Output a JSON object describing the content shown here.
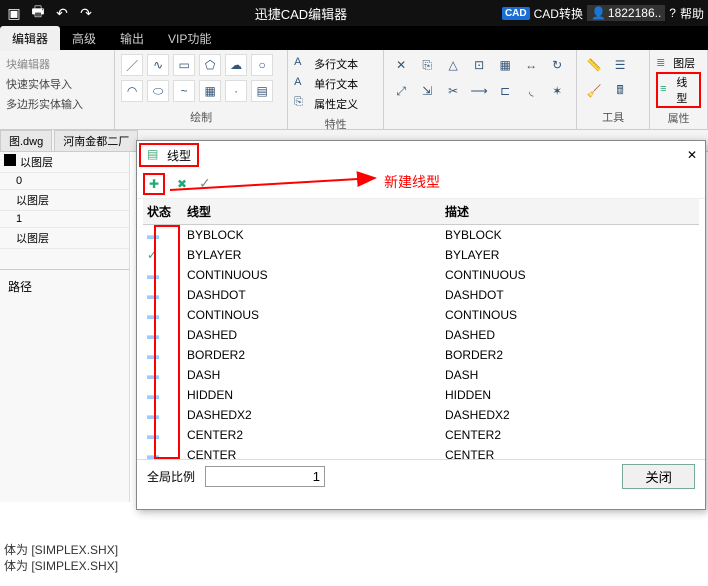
{
  "title": "迅捷CAD编辑器",
  "titlebar_right": {
    "convert": "CAD转换",
    "user": "1822186..",
    "help": "帮助"
  },
  "menus": [
    "编辑器",
    "高级",
    "输出",
    "VIP功能"
  ],
  "ribbon": {
    "quick_panel_title": "块编辑器",
    "quick_items": [
      "快速实体导入",
      "多边形实体输入"
    ],
    "draw_label": "绘制",
    "text_items": [
      "多行文本",
      "单行文本",
      "属性定义"
    ],
    "text_label": "特性",
    "tools_label": "工具",
    "layer_label": "属性",
    "layer_items": [
      "图层",
      "线型"
    ]
  },
  "tabs": [
    "图.dwg",
    "河南金都二厂"
  ],
  "props": {
    "rows": [
      {
        "label": "以图层",
        "value": "0"
      },
      {
        "label": "以图层",
        "value": "1"
      },
      {
        "label": "以图层",
        "value": ""
      }
    ],
    "path_label": "路径"
  },
  "dialog": {
    "title": "线型",
    "annotation": "新建线型",
    "columns": [
      "状态",
      "线型",
      "描述"
    ],
    "rows": [
      {
        "state": "default",
        "name": "BYBLOCK",
        "desc": "BYBLOCK"
      },
      {
        "state": "check",
        "name": "BYLAYER",
        "desc": "BYLAYER"
      },
      {
        "state": "default",
        "name": "CONTINUOUS",
        "desc": "CONTINUOUS"
      },
      {
        "state": "default",
        "name": "DASHDOT",
        "desc": "DASHDOT"
      },
      {
        "state": "default",
        "name": "CONTINOUS",
        "desc": "CONTINOUS"
      },
      {
        "state": "default",
        "name": "DASHED",
        "desc": "DASHED"
      },
      {
        "state": "default",
        "name": "BORDER2",
        "desc": "BORDER2"
      },
      {
        "state": "default",
        "name": "DASH",
        "desc": "DASH"
      },
      {
        "state": "default",
        "name": "HIDDEN",
        "desc": "HIDDEN"
      },
      {
        "state": "default",
        "name": "DASHEDX2",
        "desc": "DASHEDX2"
      },
      {
        "state": "default",
        "name": "CENTER2",
        "desc": "CENTER2"
      },
      {
        "state": "default",
        "name": "CENTER",
        "desc": "CENTER"
      }
    ],
    "scale_label": "全局比例",
    "scale_value": "1",
    "close_label": "关闭"
  },
  "status": [
    "体为 [SIMPLEX.SHX]",
    "体为 [SIMPLEX.SHX]"
  ]
}
